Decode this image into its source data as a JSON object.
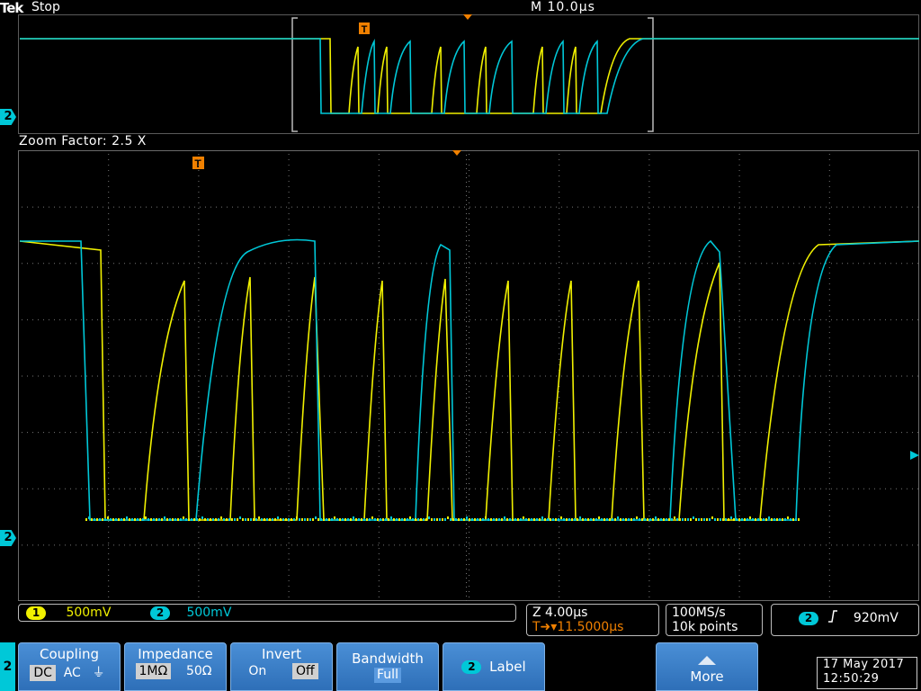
{
  "status": {
    "brand": "Tek",
    "acq_state": "Stop",
    "horizontal_scale": "M 10.0µs"
  },
  "overview": {
    "zoom_factor": "Zoom Factor: 2.5 X",
    "ch2_marker": "2"
  },
  "main": {
    "ch2_marker": "2",
    "trigger_marker": "T"
  },
  "channels": [
    {
      "id": "1",
      "scale": "500mV",
      "color": "#f0f000"
    },
    {
      "id": "2",
      "scale": "500mV",
      "color": "#00c8d8"
    }
  ],
  "zoom_readout": {
    "zoom_scale": "Z 4.00µs",
    "trigger_pos": "T➜▾11.5000µs"
  },
  "acquisition": {
    "sample_rate": "100MS/s",
    "record_length": "10k points"
  },
  "trigger": {
    "channel": "2",
    "slope_icon": "rising-edge-icon",
    "level": "920mV"
  },
  "menu": {
    "active_channel": "2",
    "coupling": {
      "title": "Coupling",
      "options": [
        "DC",
        "AC",
        "⏚"
      ],
      "selected": "DC"
    },
    "impedance": {
      "title": "Impedance",
      "options": [
        "1MΩ",
        "50Ω"
      ],
      "selected": "1MΩ"
    },
    "invert": {
      "title": "Invert",
      "options": [
        "On",
        "Off"
      ],
      "selected": "Off"
    },
    "bandwidth": {
      "title": "Bandwidth",
      "value": "Full"
    },
    "label": {
      "channel": "2",
      "title": "Label"
    },
    "more": {
      "title": "More"
    }
  },
  "datetime": {
    "date": "17 May 2017",
    "time": "12:50:29"
  }
}
